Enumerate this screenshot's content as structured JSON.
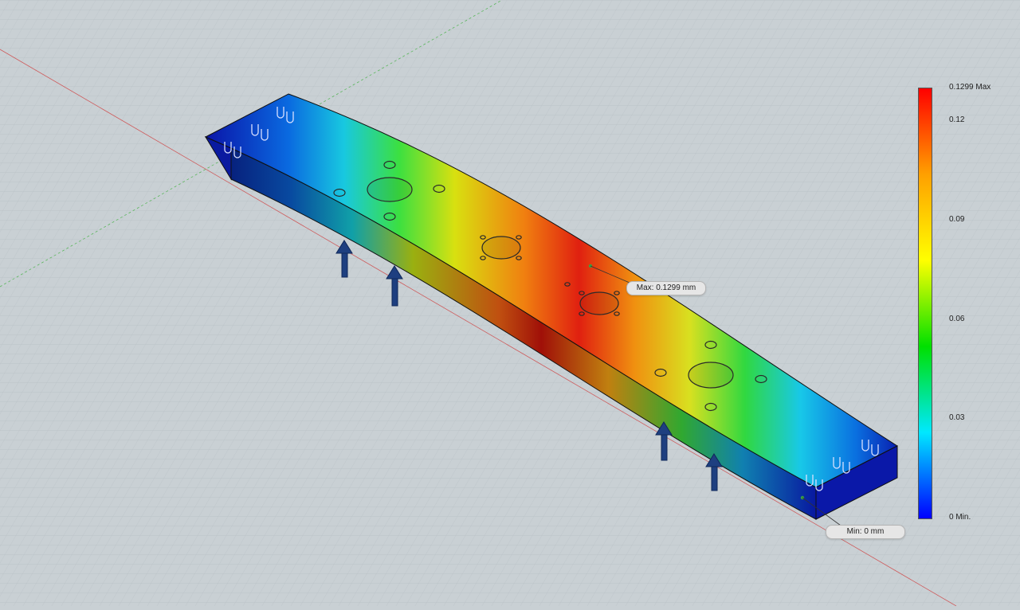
{
  "viewport": {
    "probes": {
      "max_label": "Max: 0.1299 mm",
      "min_label": "Min: 0 mm"
    }
  },
  "legend": {
    "unit": "mm",
    "range": [
      0,
      0.1299
    ],
    "ticks": [
      "0.1299 Max",
      "0.12",
      "0.09",
      "0.06",
      "0.03",
      "0 Min."
    ],
    "colors": [
      "#ff0000",
      "#ffa000",
      "#ffff00",
      "#00e000",
      "#00e8ff",
      "#0000ff"
    ]
  },
  "scene": {
    "grid_color": "#aab3b9",
    "background": "#c9d0d4",
    "load_arrow_color": "#1e3f80",
    "axis_x_color": "#d04040",
    "axis_y_color": "#40b040"
  }
}
